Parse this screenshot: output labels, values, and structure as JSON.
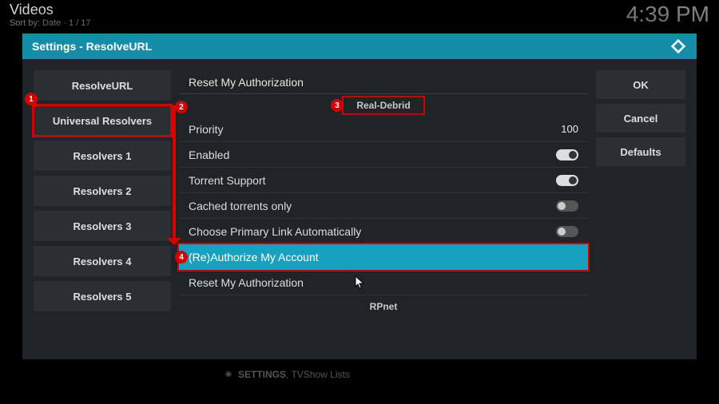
{
  "topbar": {
    "title": "Videos",
    "sort": "Sort by: Date  ·  1 / 17",
    "clock": "4:39 PM"
  },
  "dialog": {
    "title": "Settings - ResolveURL"
  },
  "sidebar": {
    "items": [
      {
        "label": "ResolveURL"
      },
      {
        "label": "Universal Resolvers"
      },
      {
        "label": "Resolvers 1"
      },
      {
        "label": "Resolvers 2"
      },
      {
        "label": "Resolvers 3"
      },
      {
        "label": "Resolvers 4"
      },
      {
        "label": "Resolvers 5"
      }
    ]
  },
  "main": {
    "top_action": "Reset My Authorization",
    "group": "Real-Debrid",
    "rows": [
      {
        "label": "Priority",
        "kind": "value",
        "value": "100"
      },
      {
        "label": "Enabled",
        "kind": "toggle",
        "on": true
      },
      {
        "label": "Torrent Support",
        "kind": "toggle",
        "on": true
      },
      {
        "label": "Cached torrents only",
        "kind": "toggle",
        "on": false
      },
      {
        "label": "Choose Primary Link Automatically",
        "kind": "toggle",
        "on": false
      },
      {
        "label": "(Re)Authorize My Account",
        "kind": "action",
        "highlight": true
      },
      {
        "label": "Reset My Authorization",
        "kind": "action"
      }
    ],
    "next_group": "RPnet"
  },
  "buttons": {
    "ok": "OK",
    "cancel": "Cancel",
    "defaults": "Defaults"
  },
  "badges": {
    "b1": "1",
    "b2": "2",
    "b3": "3",
    "b4": "4"
  },
  "footer": {
    "line1a": "SETTINGS",
    "line1b": ", TVShow Lists"
  }
}
